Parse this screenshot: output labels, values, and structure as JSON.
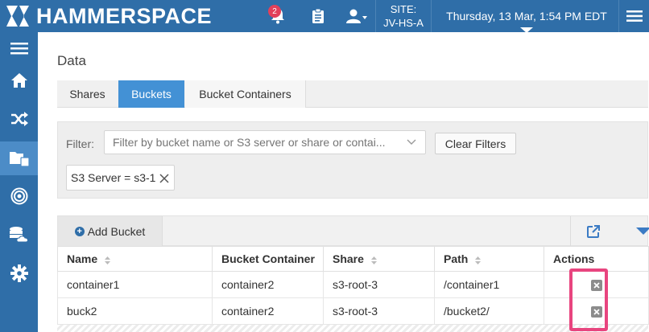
{
  "header": {
    "brand": "HAMMERSPACE",
    "notification_count": "2",
    "site_label": "SITE:",
    "site_name": "JV-HS-A",
    "datetime": "Thursday, 13 Mar, 1:54 PM EDT",
    "brand_color": "#2f6ea8"
  },
  "sidebar": {
    "items": [
      {
        "icon": "hamburger-icon"
      },
      {
        "icon": "home-icon"
      },
      {
        "icon": "shuffle-icon"
      },
      {
        "icon": "files-icon",
        "active": true
      },
      {
        "icon": "target-icon"
      },
      {
        "icon": "cloud-storage-icon"
      },
      {
        "icon": "gear-icon"
      }
    ]
  },
  "page": {
    "title": "Data"
  },
  "tabs": [
    {
      "label": "Shares"
    },
    {
      "label": "Buckets",
      "active": true
    },
    {
      "label": "Bucket Containers"
    }
  ],
  "filter": {
    "label": "Filter:",
    "placeholder": "Filter by bucket name or S3 server or share or contai...",
    "clear_label": "Clear Filters",
    "chips": [
      {
        "label": "S3 Server = s3-1"
      }
    ]
  },
  "toolbar": {
    "add_label": "Add Bucket"
  },
  "table": {
    "columns": [
      "Name",
      "Bucket Container",
      "Share",
      "Path",
      "Actions"
    ],
    "rows": [
      {
        "name": "container1",
        "container": "container2",
        "share": "s3-root-3",
        "path": "/container1"
      },
      {
        "name": "buck2",
        "container": "container2",
        "share": "s3-root-3",
        "path": "/bucket2/"
      }
    ]
  },
  "colors": {
    "active_tab": "#4391d5",
    "highlight": "#e8457f"
  }
}
